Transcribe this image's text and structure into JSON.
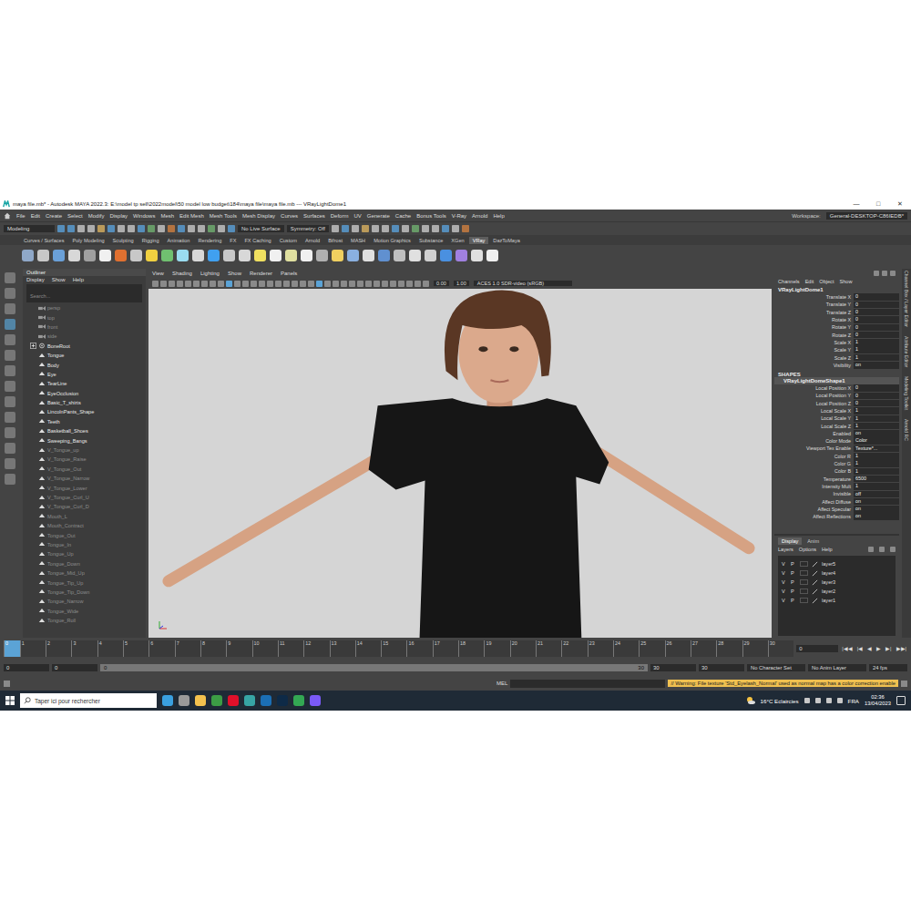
{
  "window": {
    "title": "maya file.mb* - Autodesk MAYA 2022.3: E:\\model tp sell\\2022model\\50 model low budget\\184\\maya file\\maya file.mb  ---  VRayLightDome1",
    "controls": [
      "—",
      "□",
      "✕"
    ]
  },
  "menu_bar": {
    "items": [
      "File",
      "Edit",
      "Create",
      "Select",
      "Modify",
      "Display",
      "Windows",
      "Mesh",
      "Edit Mesh",
      "Mesh Tools",
      "Mesh Display",
      "Curves",
      "Surfaces",
      "Deform",
      "UV",
      "Generate",
      "Cache",
      "Bonus Tools",
      "V-Ray",
      "Arnold",
      "Help"
    ],
    "workspace_label": "Workspace:",
    "workspace": "General-DESKTOP-C86IEDB*"
  },
  "status_line": {
    "mode": "Modeling",
    "live_surface": "No Live Surface",
    "symmetry": "Symmetry: Off"
  },
  "shelf": {
    "tabs": [
      {
        "label": "Curves / Surfaces",
        "selected": false
      },
      {
        "label": "Poly Modeling",
        "selected": false
      },
      {
        "label": "Sculpting",
        "selected": false
      },
      {
        "label": "Rigging",
        "selected": false
      },
      {
        "label": "Animation",
        "selected": false
      },
      {
        "label": "Rendering",
        "selected": false
      },
      {
        "label": "FX",
        "selected": false
      },
      {
        "label": "FX Caching",
        "selected": false
      },
      {
        "label": "Custom",
        "selected": false
      },
      {
        "label": "Arnold",
        "selected": false
      },
      {
        "label": "Bifrost",
        "selected": false
      },
      {
        "label": "MASH",
        "selected": false
      },
      {
        "label": "Motion Graphics",
        "selected": false
      },
      {
        "label": "Substance",
        "selected": false
      },
      {
        "label": "XGen",
        "selected": false
      },
      {
        "label": "VRay",
        "selected": true
      },
      {
        "label": "DazToMaya",
        "selected": false
      }
    ]
  },
  "outliner": {
    "title": "Outliner",
    "menu": [
      "Display",
      "Show",
      "Help"
    ],
    "search": {
      "placeholder": "Search..."
    },
    "items": [
      {
        "label": "persp",
        "kind": "camera",
        "dimmed": true,
        "expandable": false
      },
      {
        "label": "top",
        "kind": "camera",
        "dimmed": true,
        "expandable": false
      },
      {
        "label": "front",
        "kind": "camera",
        "dimmed": true,
        "expandable": false
      },
      {
        "label": "side",
        "kind": "camera",
        "dimmed": true,
        "expandable": false
      },
      {
        "label": "BoneRoot",
        "kind": "joint",
        "dimmed": false,
        "expandable": true
      },
      {
        "label": "Tongue",
        "kind": "mesh",
        "dimmed": false,
        "expandable": false
      },
      {
        "label": "Body",
        "kind": "mesh",
        "dimmed": false,
        "expandable": false
      },
      {
        "label": "Eye",
        "kind": "mesh",
        "dimmed": false,
        "expandable": false
      },
      {
        "label": "TearLine",
        "kind": "mesh",
        "dimmed": false,
        "expandable": false
      },
      {
        "label": "EyeOcclusion",
        "kind": "mesh",
        "dimmed": false,
        "expandable": false
      },
      {
        "label": "Basic_T_shirts",
        "kind": "mesh",
        "dimmed": false,
        "expandable": false
      },
      {
        "label": "LincolnPants_Shape",
        "kind": "mesh",
        "dimmed": false,
        "expandable": false
      },
      {
        "label": "Teeth",
        "kind": "mesh",
        "dimmed": false,
        "expandable": false
      },
      {
        "label": "Basketball_Shoes",
        "kind": "mesh",
        "dimmed": false,
        "expandable": false
      },
      {
        "label": "Sweeping_Bangs",
        "kind": "mesh",
        "dimmed": false,
        "expandable": false
      },
      {
        "label": "V_Tongue_up",
        "kind": "mesh",
        "dimmed": true,
        "expandable": false
      },
      {
        "label": "V_Tongue_Raise",
        "kind": "mesh",
        "dimmed": true,
        "expandable": false
      },
      {
        "label": "V_Tongue_Out",
        "kind": "mesh",
        "dimmed": true,
        "expandable": false
      },
      {
        "label": "V_Tongue_Narrow",
        "kind": "mesh",
        "dimmed": true,
        "expandable": false
      },
      {
        "label": "V_Tongue_Lower",
        "kind": "mesh",
        "dimmed": true,
        "expandable": false
      },
      {
        "label": "V_Tongue_Curl_U",
        "kind": "mesh",
        "dimmed": true,
        "expandable": false
      },
      {
        "label": "V_Tongue_Curl_D",
        "kind": "mesh",
        "dimmed": true,
        "expandable": false
      },
      {
        "label": "Mouth_L",
        "kind": "mesh",
        "dimmed": true,
        "expandable": false
      },
      {
        "label": "Mouth_Contract",
        "kind": "mesh",
        "dimmed": true,
        "expandable": false
      },
      {
        "label": "Tongue_Out",
        "kind": "mesh",
        "dimmed": true,
        "expandable": false
      },
      {
        "label": "Tongue_In",
        "kind": "mesh",
        "dimmed": true,
        "expandable": false
      },
      {
        "label": "Tongue_Up",
        "kind": "mesh",
        "dimmed": true,
        "expandable": false
      },
      {
        "label": "Tongue_Down",
        "kind": "mesh",
        "dimmed": true,
        "expandable": false
      },
      {
        "label": "Tongue_Mid_Up",
        "kind": "mesh",
        "dimmed": true,
        "expandable": false
      },
      {
        "label": "Tongue_Tip_Up",
        "kind": "mesh",
        "dimmed": true,
        "expandable": false
      },
      {
        "label": "Tongue_Tip_Down",
        "kind": "mesh",
        "dimmed": true,
        "expandable": false
      },
      {
        "label": "Tongue_Narrow",
        "kind": "mesh",
        "dimmed": true,
        "expandable": false
      },
      {
        "label": "Tongue_Wide",
        "kind": "mesh",
        "dimmed": true,
        "expandable": false
      },
      {
        "label": "Tongue_Roll",
        "kind": "mesh",
        "dimmed": true,
        "expandable": false
      }
    ]
  },
  "viewport": {
    "menu": [
      "View",
      "Shading",
      "Lighting",
      "Show",
      "Renderer",
      "Panels"
    ],
    "exposure": "0.00",
    "gamma": "1.00",
    "color_space": "ACES 1.0 SDR-video (sRGB)"
  },
  "channel_box": {
    "menu": [
      "Channels",
      "Edit",
      "Object",
      "Show"
    ],
    "object": "VRayLightDome1",
    "attributes": [
      {
        "name": "Translate X",
        "value": "0"
      },
      {
        "name": "Translate Y",
        "value": "0"
      },
      {
        "name": "Translate Z",
        "value": "0"
      },
      {
        "name": "Rotate X",
        "value": "0"
      },
      {
        "name": "Rotate Y",
        "value": "0"
      },
      {
        "name": "Rotate Z",
        "value": "0"
      },
      {
        "name": "Scale X",
        "value": "1"
      },
      {
        "name": "Scale Y",
        "value": "1"
      },
      {
        "name": "Scale Z",
        "value": "1"
      },
      {
        "name": "Visibility",
        "value": "on"
      }
    ],
    "shapes_label": "SHAPES",
    "shape": "VRayLightDomeShape1",
    "shape_attributes": [
      {
        "name": "Local Position X",
        "value": "0"
      },
      {
        "name": "Local Position Y",
        "value": "0"
      },
      {
        "name": "Local Position Z",
        "value": "0"
      },
      {
        "name": "Local Scale X",
        "value": "1"
      },
      {
        "name": "Local Scale Y",
        "value": "1"
      },
      {
        "name": "Local Scale Z",
        "value": "1"
      },
      {
        "name": "Enabled",
        "value": "on"
      },
      {
        "name": "Color Mode",
        "value": "Color"
      },
      {
        "name": "Viewport Tex Enable",
        "value": "Texture*..."
      },
      {
        "name": "Color R",
        "value": "1"
      },
      {
        "name": "Color G",
        "value": "1"
      },
      {
        "name": "Color B",
        "value": "1"
      },
      {
        "name": "Temperature",
        "value": "6500"
      },
      {
        "name": "Intensity Mult",
        "value": "1"
      },
      {
        "name": "Invisible",
        "value": "off"
      },
      {
        "name": "Affect Diffuse",
        "value": "on"
      },
      {
        "name": "Affect Specular",
        "value": "on"
      },
      {
        "name": "Affect Reflections",
        "value": "on"
      }
    ]
  },
  "layer_editor": {
    "tabs": [
      {
        "label": "Display",
        "selected": true
      },
      {
        "label": "Anim",
        "selected": false
      }
    ],
    "menu": [
      "Layers",
      "Options",
      "Help"
    ],
    "layers": [
      {
        "v": "V",
        "p": "P",
        "name": "layer5"
      },
      {
        "v": "V",
        "p": "P",
        "name": "layer4"
      },
      {
        "v": "V",
        "p": "P",
        "name": "layer3"
      },
      {
        "v": "V",
        "p": "P",
        "name": "layer2"
      },
      {
        "v": "V",
        "p": "P",
        "name": "layer1"
      }
    ]
  },
  "side_tabs": [
    "Channel Box / Layer Editor",
    "Attribute Editor",
    "Modeling Toolkit",
    "Arnold RC"
  ],
  "timeline": {
    "ticks": [
      "0",
      "1",
      "2",
      "3",
      "4",
      "5",
      "6",
      "7",
      "8",
      "9",
      "10",
      "11",
      "12",
      "13",
      "14",
      "15",
      "16",
      "17",
      "18",
      "19",
      "20",
      "21",
      "22",
      "23",
      "24",
      "25",
      "26",
      "27",
      "28",
      "29",
      "30"
    ],
    "current_frame": "0",
    "playback": [
      "|◀◀",
      "|◀",
      "◀",
      "▶",
      "▶|",
      "▶▶|"
    ]
  },
  "range": {
    "start": "0",
    "playback_start": "0",
    "slider_start": "0",
    "slider_end": "30",
    "playback_end": "30",
    "end": "30",
    "character_set": "No Character Set",
    "anim_layer": "No Anim Layer",
    "fps": "24 fps"
  },
  "command_line": {
    "language": "MEL",
    "response": "// Warning: File texture 'Std_Eyelash_Normal' used as normal map has a color correction enable"
  },
  "taskbar": {
    "search": "Taper ici pour rechercher",
    "apps": [
      {
        "color": "#3aa0e0"
      },
      {
        "color": "#9a9a9a"
      },
      {
        "color": "#f2c14e"
      },
      {
        "color": "#3c9d45"
      },
      {
        "color": "#e0102a"
      },
      {
        "color": "#37a5a5"
      },
      {
        "color": "#1b6fb5"
      },
      {
        "color": "#0e2a47"
      },
      {
        "color": "#33a853"
      },
      {
        "color": "#7a5af8"
      }
    ],
    "weather": "16°C  Eclaircies",
    "language": "FRA",
    "time": "02:36",
    "date": "13/04/2023"
  }
}
